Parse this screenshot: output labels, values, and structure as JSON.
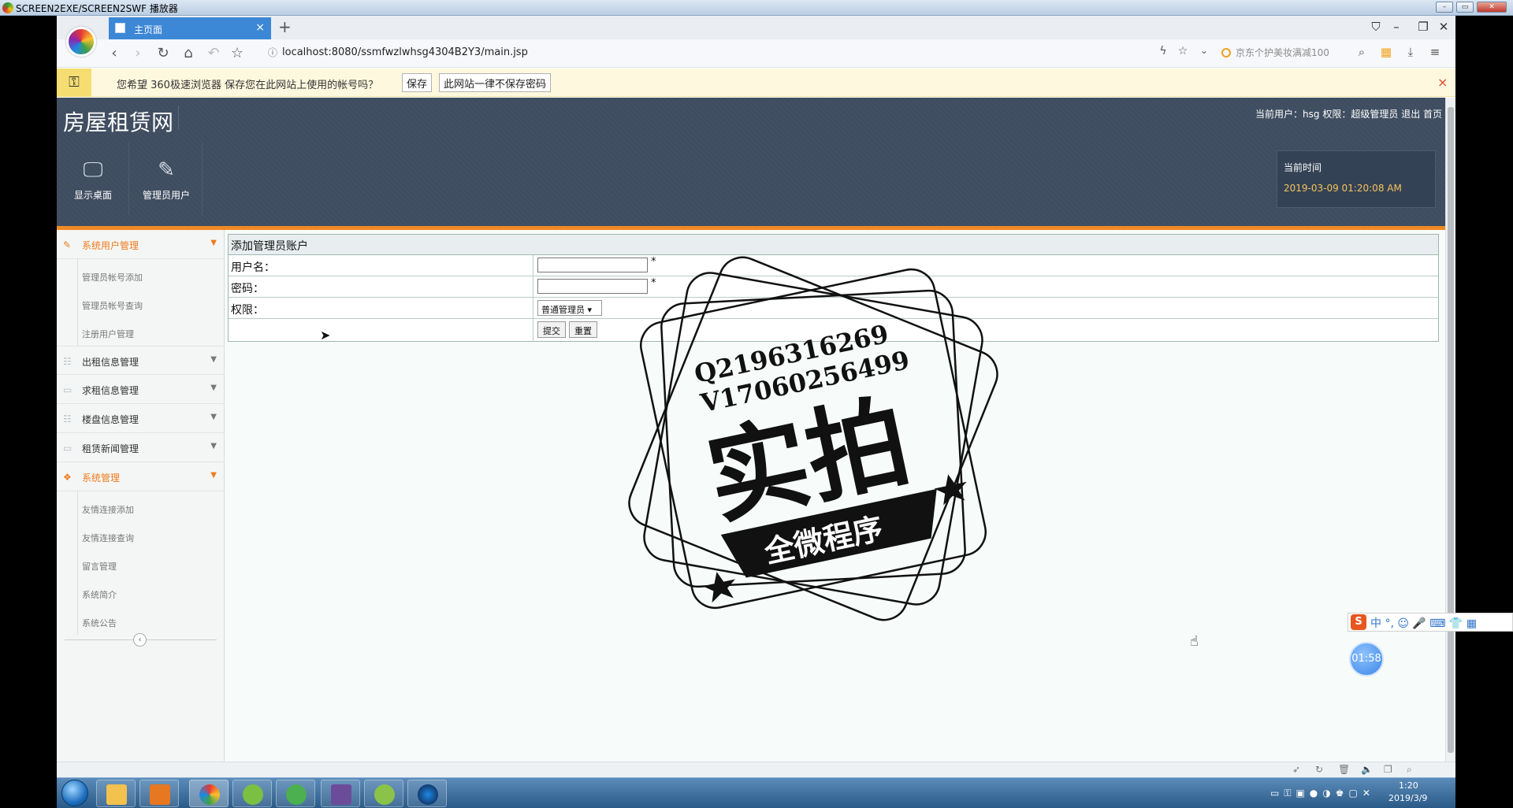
{
  "player": {
    "title": "SCREEN2EXE/SCREEN2SWF 播放器",
    "controls": [
      "–",
      "▭",
      "✕"
    ]
  },
  "browser": {
    "tab_title": "主页面",
    "tab_close": "×",
    "new_tab": "+",
    "url": "localhost:8080/ssmfwzlwhsg4304B2Y3/main.jsp",
    "search_placeholder": "京东个护美妆满减100",
    "window_controls": [
      "⌂",
      "–",
      "❐",
      "✕"
    ],
    "nav": {
      "back": "‹",
      "forward": "›",
      "reload": "↻",
      "home": "⌂",
      "undo": "↶",
      "star": "☆"
    }
  },
  "password_bar": {
    "icon": "key-icon",
    "message": "您希望 360极速浏览器 保存您在此网站上使用的帐号吗？",
    "save_label": "保存",
    "never_label": "此网站一律不保存密码",
    "close": "×"
  },
  "site": {
    "title": "房屋租赁网",
    "user_info": {
      "user_prefix": "当前用户：",
      "user": "hsg",
      "role_prefix": "权限：",
      "role": "超级管理员",
      "logout": "退出",
      "home": "首页"
    },
    "tiles": [
      {
        "label": "显示桌面",
        "icon": "monitor-icon"
      },
      {
        "label": "管理员用户",
        "icon": "pencil-icon"
      }
    ],
    "time_label": "当前时间",
    "time_value": "2019-03-09 01:20:08 AM"
  },
  "sidebar": {
    "groups": [
      {
        "label": "系统用户管理",
        "active": true,
        "items": [
          "管理员帐号添加",
          "管理员帐号查询",
          "注册用户管理"
        ]
      },
      {
        "label": "出租信息管理",
        "active": false,
        "items": []
      },
      {
        "label": "求租信息管理",
        "active": false,
        "items": []
      },
      {
        "label": "楼盘信息管理",
        "active": false,
        "items": []
      },
      {
        "label": "租赁新闻管理",
        "active": false,
        "items": []
      },
      {
        "label": "系统管理",
        "active": true,
        "items": [
          "友情连接添加",
          "友情连接查询",
          "留言管理",
          "系统简介",
          "系统公告"
        ]
      }
    ],
    "collapse": "‹"
  },
  "form": {
    "title": "添加管理员账户",
    "username_label": "用户名：",
    "password_label": "密码：",
    "role_label": "权限：",
    "required_mark": "*",
    "role_selected": "普通管理员",
    "submit_label": "提交",
    "reset_label": "重置"
  },
  "watermark": {
    "line1": "Q2196316269",
    "line2": "V17060256499",
    "main": "实拍",
    "ribbon": "全微程序"
  },
  "ime": {
    "logo": "S",
    "text": "中 °, ☺ 🎤 ⌨ 👕 ▦"
  },
  "timer": "01:58",
  "taskbar": {
    "time": "1:20",
    "date": "2019/3/9"
  },
  "colors": {
    "header_bg": "#3f4d60",
    "accent_orange": "#f08a24",
    "tab_blue": "#3c87d6",
    "time_yellow": "#f5c35a"
  }
}
